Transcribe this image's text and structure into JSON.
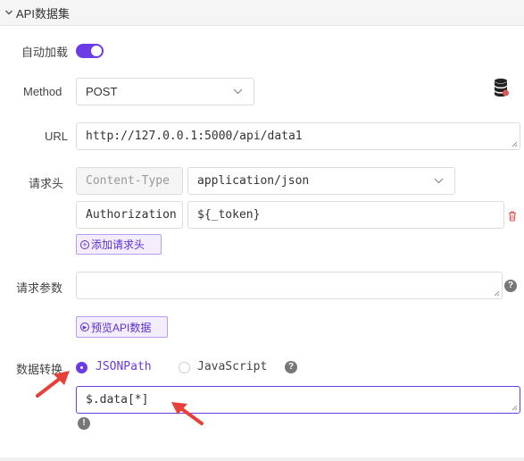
{
  "panel": {
    "title": "API数据集"
  },
  "auto_load": {
    "label": "自动加载",
    "enabled": true
  },
  "method": {
    "label": "Method",
    "value": "POST"
  },
  "url": {
    "label": "URL",
    "value": "http://127.0.0.1:5000/api/data1"
  },
  "headers": {
    "label": "请求头",
    "rows": [
      {
        "key": "Content-Type",
        "value": "application/json"
      },
      {
        "key": "Authorization",
        "value": "${_token}"
      }
    ],
    "add_label": "添加请求头"
  },
  "params": {
    "label": "请求参数",
    "value": ""
  },
  "preview": {
    "label": "预览API数据"
  },
  "transform": {
    "label": "数据转换",
    "options": [
      "JSONPath",
      "JavaScript"
    ],
    "selected": "JSONPath",
    "expression": "$.data[*]"
  },
  "colors": {
    "accent": "#6b3be6",
    "annotation": "#e5413a",
    "danger": "#e05555"
  },
  "icons": [
    "chevron-down-icon",
    "database-icon",
    "trash-icon",
    "help-icon",
    "info-icon",
    "arrow-annotation-icon"
  ]
}
